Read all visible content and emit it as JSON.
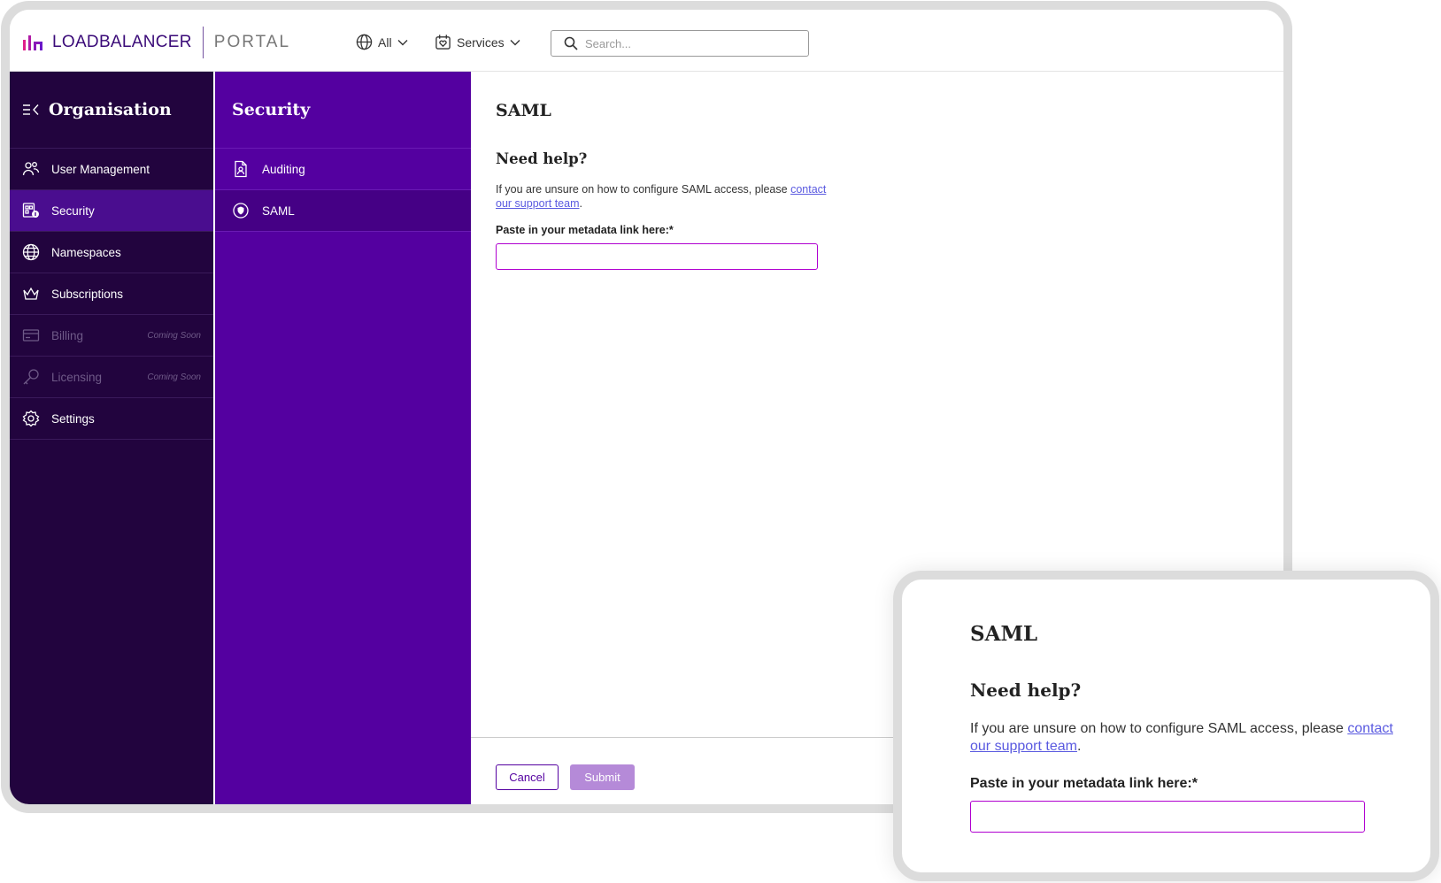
{
  "topbar": {
    "logo_text": "LOADBALANCER",
    "logo_portal": "PORTAL",
    "region_dropdown": "All",
    "services_dropdown": "Services",
    "search_placeholder": "Search..."
  },
  "sidebar": {
    "title": "Organisation",
    "items": [
      {
        "label": "User Management",
        "icon": "users-icon",
        "active": false,
        "disabled": false,
        "badge": ""
      },
      {
        "label": "Security",
        "icon": "security-icon",
        "active": true,
        "disabled": false,
        "badge": ""
      },
      {
        "label": "Namespaces",
        "icon": "globe-icon",
        "active": false,
        "disabled": false,
        "badge": ""
      },
      {
        "label": "Subscriptions",
        "icon": "crown-icon",
        "active": false,
        "disabled": false,
        "badge": ""
      },
      {
        "label": "Billing",
        "icon": "credit-card-icon",
        "active": false,
        "disabled": true,
        "badge": "Coming Soon"
      },
      {
        "label": "Licensing",
        "icon": "key-icon",
        "active": false,
        "disabled": true,
        "badge": "Coming Soon"
      },
      {
        "label": "Settings",
        "icon": "gear-icon",
        "active": false,
        "disabled": false,
        "badge": ""
      }
    ]
  },
  "subnav": {
    "title": "Security",
    "items": [
      {
        "label": "Auditing",
        "icon": "document-icon",
        "active": false
      },
      {
        "label": "SAML",
        "icon": "shield-icon",
        "active": true
      }
    ]
  },
  "main": {
    "title": "SAML",
    "help_title": "Need help?",
    "help_text": "If you are unsure on how to configure SAML access, please contact our support team.",
    "help_link": "contact our support team",
    "help_suffix": ".",
    "metadata_label": "Paste in your metadata link here:*",
    "metadata_value": "",
    "cancel_label": "Cancel",
    "submit_label": "Submit"
  },
  "colors": {
    "sidebar_bg": "#22043e",
    "subnav_bg": "#5400a0",
    "accent": "#5400a0",
    "input_border": "#b000d0",
    "submit_bg": "#b58ad8",
    "link": "#5a5ae0"
  }
}
